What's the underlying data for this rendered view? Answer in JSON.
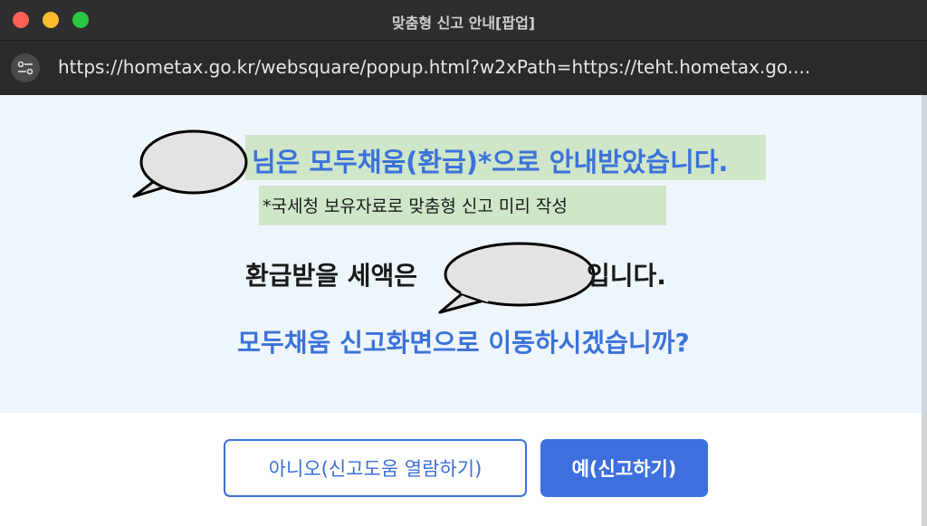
{
  "window": {
    "title": "맞춤형 신고 안내[팝업]",
    "url": "https://hometax.go.kr/websquare/popup.html?w2xPath=https://teht.hometax.go...."
  },
  "content": {
    "headline": "님은 모두채움(환급)*으로 안내받았습니다.",
    "subnote": "*국세청 보유자료로 맞춤형 신고 미리 작성",
    "refund_label": "환급받을 세액은",
    "refund_suffix": "입니다.",
    "question": "모두채움 신고화면으로 이동하시겠습니까?"
  },
  "buttons": {
    "no_label": "아니오(신고도움 열람하기)",
    "yes_label": "예(신고하기)"
  },
  "colors": {
    "accent": "#3b72d9",
    "highlight": "#cfe6c9",
    "content_bg": "#eef5fb"
  }
}
